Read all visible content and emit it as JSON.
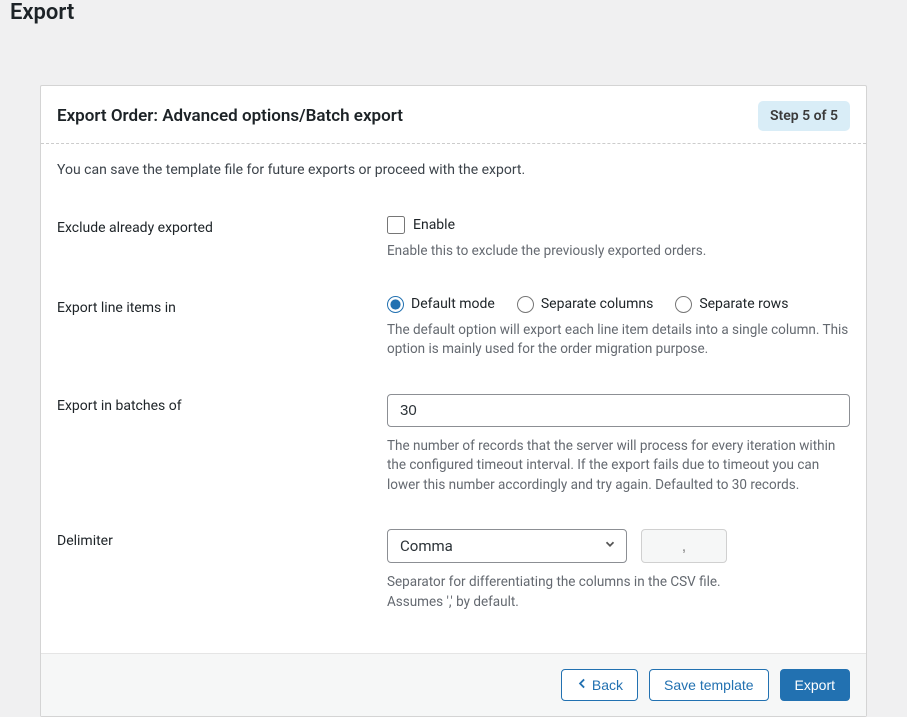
{
  "page": {
    "title": "Export"
  },
  "panel": {
    "title": "Export Order: Advanced options/Batch export",
    "step_label": "Step 5 of 5",
    "intro": "You can save the template file for future exports or proceed with the export."
  },
  "fields": {
    "exclude_exported": {
      "label": "Exclude already exported",
      "checkbox_label": "Enable",
      "help": "Enable this to exclude the previously exported orders."
    },
    "line_items": {
      "label": "Export line items in",
      "options": {
        "default": "Default mode",
        "separate_columns": "Separate columns",
        "separate_rows": "Separate rows"
      },
      "help": "The default option will export each line item details into a single column. This option is mainly used for the order migration purpose."
    },
    "batches": {
      "label": "Export in batches of",
      "value": "30",
      "help": "The number of records that the server will process for every iteration within the configured timeout interval. If the export fails due to timeout you can lower this number accordingly and try again. Defaulted to 30 records."
    },
    "delimiter": {
      "label": "Delimiter",
      "selected": "Comma",
      "display_char": ",",
      "help_line1": "Separator for differentiating the columns in the CSV file.",
      "help_line2": "Assumes ',' by default."
    }
  },
  "footer": {
    "back": "Back",
    "save_template": "Save template",
    "export": "Export"
  }
}
